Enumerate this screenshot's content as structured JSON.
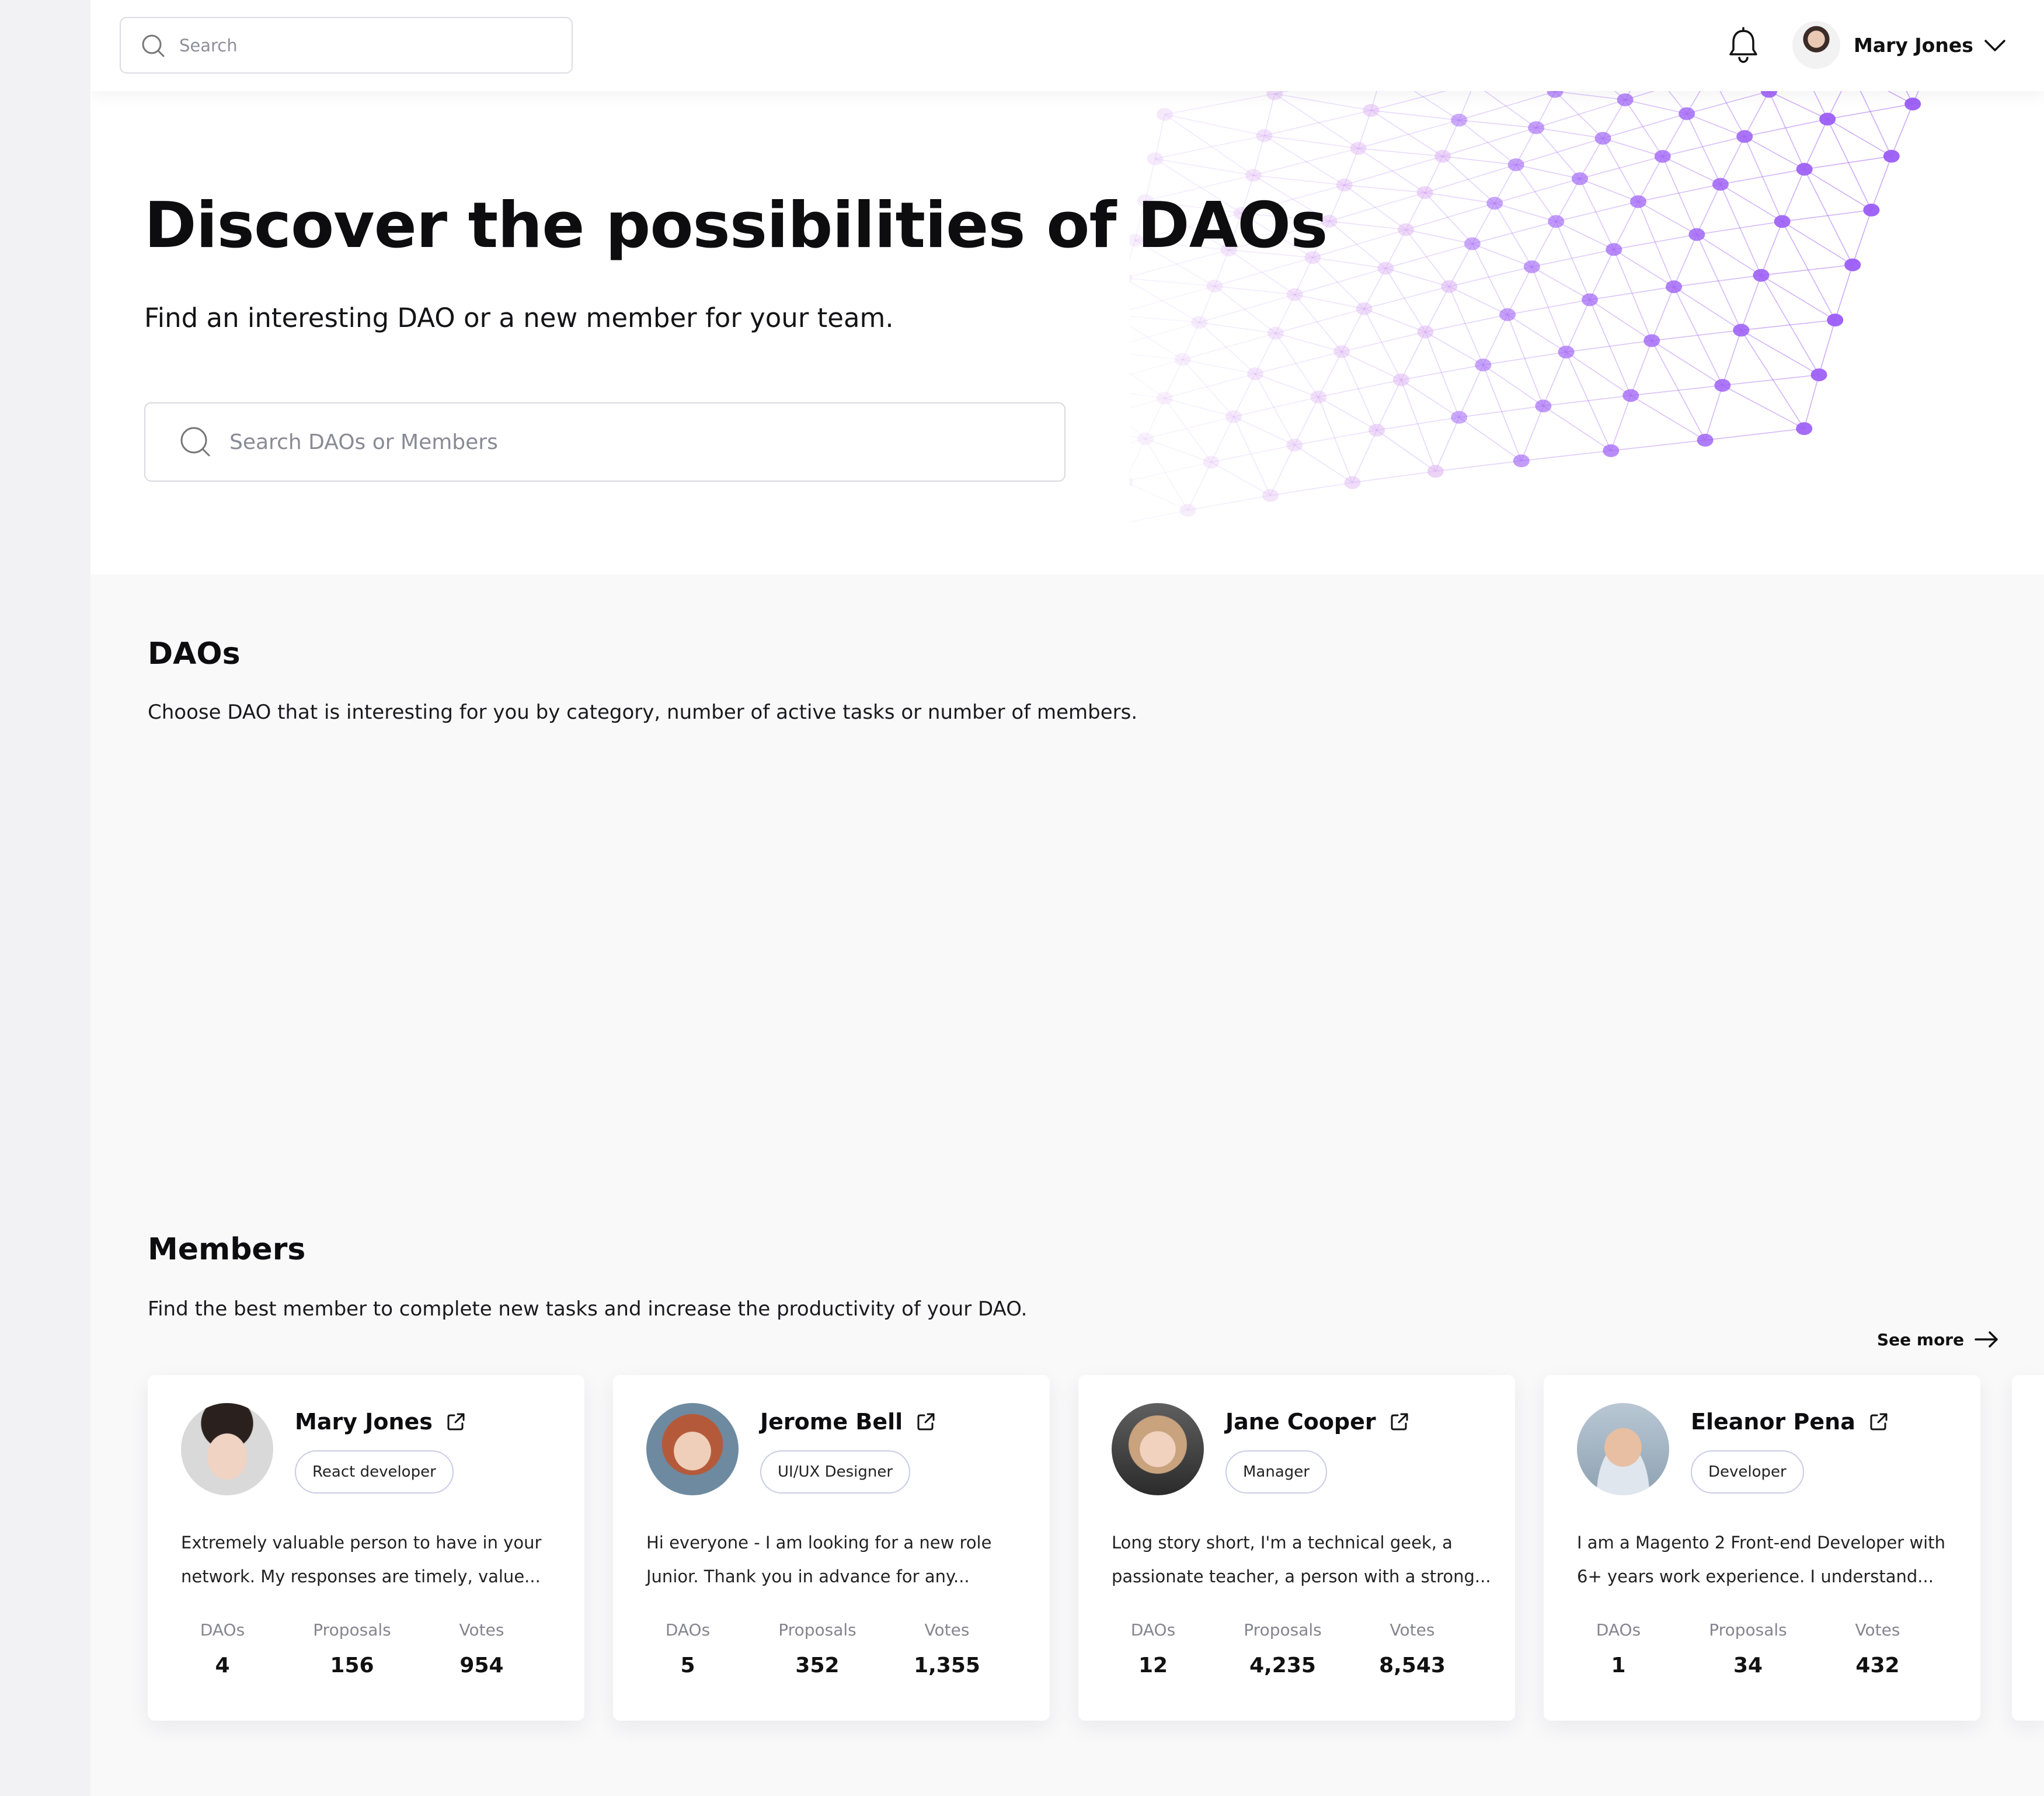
{
  "header": {
    "search": {
      "placeholder": "Search"
    },
    "user": {
      "name": "Mary Jones"
    }
  },
  "hero": {
    "title": "Discover the possibilities of DAOs",
    "subtitle": "Find an interesting DAO or a new member for your team.",
    "search": {
      "placeholder": "Search DAOs or Members"
    }
  },
  "daos": {
    "title": "DAOs",
    "description": "Choose DAO that is interesting for you by category, number of active tasks or number of members."
  },
  "members": {
    "title": "Members",
    "description": "Find the best member to complete new tasks and increase the productivity of your DAO.",
    "see_more": "See more",
    "stat_labels": {
      "daos": "DAOs",
      "proposals": "Proposals",
      "votes": "Votes"
    },
    "cards": [
      {
        "name": "Mary Jones",
        "role": "React developer",
        "bio": "Extremely valuable person to have in your network. My responses are timely, value...",
        "daos": "4",
        "proposals": "156",
        "votes": "954"
      },
      {
        "name": "Jerome Bell",
        "role": "UI/UX Designer",
        "bio": "Hi everyone - I am looking for a new role Junior. Thank you in advance for any...",
        "daos": "5",
        "proposals": "352",
        "votes": "1,355"
      },
      {
        "name": "Jane Cooper",
        "role": "Manager",
        "bio": "Long story short, I'm a technical geek, a passionate teacher, a person with a strong...",
        "daos": "12",
        "proposals": "4,235",
        "votes": "8,543"
      },
      {
        "name": "Eleanor Pena",
        "role": "Developer",
        "bio": "I am a Magento 2 Front-end Developer with 6+ years work experience. I understand...",
        "daos": "1",
        "proposals": "34",
        "votes": "432"
      }
    ]
  },
  "icons": {
    "search": "search-icon",
    "bell": "bell-icon",
    "chevron": "chevron-down-icon",
    "external": "external-link-icon",
    "arrow": "arrow-right-icon"
  },
  "colors": {
    "accent_purple": "#9b5cf5",
    "role_badge_border": "#cbcbe8",
    "background": "#f9f9fa"
  }
}
